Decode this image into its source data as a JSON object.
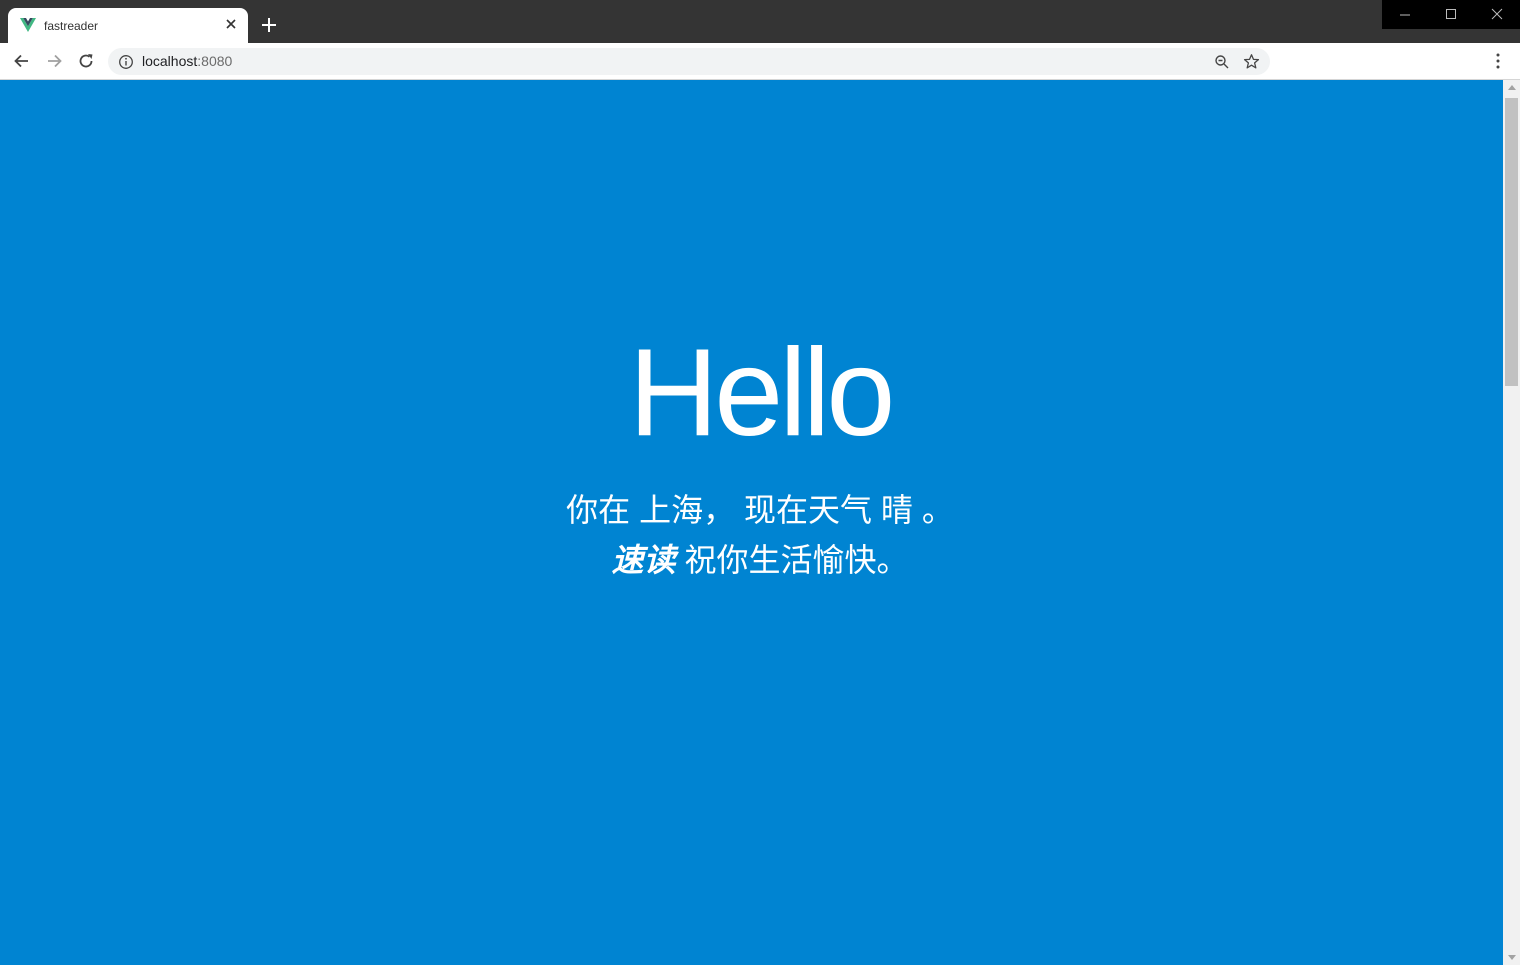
{
  "browser": {
    "tab_title": "fastreader",
    "url_host": "localhost",
    "url_port": ":8080",
    "favicon": "vue-logo-icon"
  },
  "page": {
    "greeting": "Hello",
    "line1": {
      "prefix": "你在",
      "city": "上海",
      "comma": "，",
      "weather_prefix": "现在天气",
      "weather": "晴",
      "period": "。"
    },
    "line2": {
      "brand": "速读",
      "message": "祝你生活愉快。"
    }
  },
  "colors": {
    "background": "#0084d2",
    "text": "#ffffff"
  }
}
